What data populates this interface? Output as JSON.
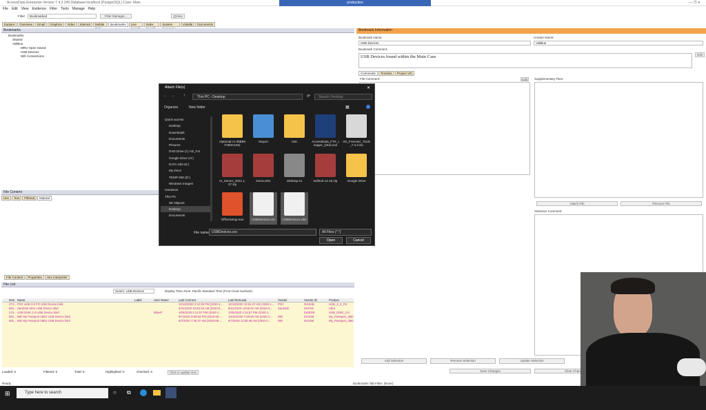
{
  "window": {
    "title": "AccessData Enterprise Version 7.4.2.249 Database:localhost (PostgreSQL) Case: Main",
    "remote_title": "production"
  },
  "menu": [
    "File",
    "Edit",
    "View",
    "Evidence",
    "Filter",
    "Tools",
    "Manage",
    "Help"
  ],
  "toolbar": {
    "filter_label": "Filter:",
    "filter_value": "Bookmarked",
    "filter_manager": "Filter Manager...",
    "qview": "QView"
  },
  "tabs": [
    "Explore",
    "Overview",
    "Email",
    "Graphics",
    "Video",
    "Internet",
    "Mobile Data",
    "Bookmarks",
    "Live Search",
    "Index Search",
    "System Summary",
    "Volatile",
    "Documents"
  ],
  "bookmarks_panel": {
    "header": "Bookmarks",
    "tree": [
      "Bookmarks",
      "Shared",
      "VolBlue",
      "MRU Open Saved",
      "USB Devices",
      "Wifi Connections"
    ]
  },
  "file_content": {
    "header": "File Content",
    "subtabs": [
      "Hex",
      "Text",
      "Filtered",
      "Natural"
    ]
  },
  "bottom_tabs": [
    "File Content",
    "Properties",
    "Hex Interpreter"
  ],
  "file_list": {
    "header": "File List",
    "summary": "Summ: USB Devices",
    "timezone": "Display Time Zone: Pacific Standard Time  (From local machine)",
    "columns": [
      "Item",
      "Name",
      "Label",
      "User Name",
      "Last Connect",
      "Last Removal",
      "Vendor",
      "Vendor ID",
      "Product"
    ],
    "rows": [
      [
        "274...",
        "PNY USB 3.0 FD USB Device.lnkd",
        "",
        "",
        "12/10/2020 2:12:28 PM (2020-1...",
        "12/10/2020 10:51:47 AM (2020-1...",
        "PNY",
        "0x154B",
        "USB_3_0_FD"
      ],
      [
        "591...",
        "SanDisk Ultra USB Device.lnkd",
        "",
        "",
        "8/31/2020 10:53:33 AM (2020-0...",
        "8/31/2020 10:55:31 AM (2020-0...",
        "SanDisk",
        "0x0781",
        "Ultra"
      ],
      [
        "274...",
        "USB DISK 2.0 USB Device.lnkd",
        "",
        "iBlueP",
        "10/5/2020 2:12:57 PM (2020-1...",
        "10/5/2020 2:13:57 PM (2020-1...",
        "",
        "0x0ED9",
        "USB_DISK_2.0"
      ],
      [
        "591...",
        "WD My Passport 25E2 USB Device.lnkd",
        "",
        "",
        "9/7/2020 3:59:53 PM (2020-09-...",
        "10/15/2020 7:56:50 AM (2020-1...",
        "WD",
        "0x1058",
        "My_Passport_25E2"
      ],
      [
        "591...",
        "WD My Passport 25E2 USB Device.lnkd",
        "",
        "",
        "9/7/2020 7:36:37 AM (2020-09-...",
        "9/7/2020 11:50:48 AM (2020-0...",
        "WD",
        "0x1058",
        "My_Passport_25E2"
      ]
    ],
    "status": {
      "loaded": "Loaded: 5",
      "filtered": "Filtered: 5",
      "total": "Total: 5",
      "highlighted": "Highlighted: 0",
      "checked": "Checked: 3",
      "update": "Click to update size"
    }
  },
  "bookmark_info": {
    "header": "Bookmark Information",
    "name_label": "Bookmark Name:",
    "name_value": "USB Devices",
    "creator_label": "Creator Name:",
    "creator_value": "VolBlue",
    "comment_label": "Bookmark Comment:",
    "comment_value": "USB Devices found within the Main Case",
    "edit": "Edit",
    "subtabs": [
      "Comments",
      "Timeline",
      "Project VIC"
    ],
    "file_comment": "File Comment:",
    "supp_files": "Supplementary Files:",
    "attach_file": "Attach File",
    "remove_file": "Remove File",
    "selection_comment": "Selection Comment:",
    "bottom_buttons": [
      "Add Selection",
      "Remove Selection",
      "Update Selection"
    ],
    "save_changes": "Save Changes",
    "clear_changes": "Clear Changes"
  },
  "status_bar": {
    "left": "Ready",
    "mid": "Bookmarks Tab Filter: (None)"
  },
  "dialog": {
    "title": "Attach File(s)",
    "breadcrumb": [
      "This PC",
      "Desktop"
    ],
    "search_placeholder": "Search Desktop",
    "organize": "Organize",
    "new_folder": "New folder",
    "nav": [
      "Quick access",
      "Desktop",
      "Downloads",
      "Documents",
      "Pictures",
      "DVD Drive (I:) AD_For",
      "Google Drive (H:)",
      "DATA-250 (E:)",
      "My Drive",
      "TEMP-250 (D:)",
      "Windows Images",
      "OneDrive",
      "This PC",
      "3D Objects",
      "Desktop",
      "Documents"
    ],
    "files": [
      {
        "name": "Optional-AI-39B89F350C548)",
        "color": "#f5c34a"
      },
      {
        "name": "Report",
        "color": "#4a8fd6"
      },
      {
        "name": "test",
        "color": "#f5c34a"
      },
      {
        "name": "AccessData_FTK_Imager_(x64).exe",
        "color": "#1f3f7a"
      },
      {
        "name": "AD_Forensic_Tools_7.4.2.iso",
        "color": "#d8d8d8"
      },
      {
        "name": "AI_Server_2021.1.27.zip",
        "color": "#a63d3d"
      },
      {
        "name": "Demo.001",
        "color": "#a63d3d"
      },
      {
        "name": "desktop.ini",
        "color": "#888888"
      },
      {
        "name": "exiftool-12.16.zip",
        "color": "#a63d3d"
      },
      {
        "name": "Google Drive",
        "color": "#f5c34a"
      },
      {
        "name": "OfficeSetup.exe",
        "color": "#e0522b"
      },
      {
        "name": "USBDevices.csv",
        "color": "#f0f0f0"
      },
      {
        "name": "USBDevices.xlsx",
        "color": "#f0f0f0"
      }
    ],
    "filename_label": "File name:",
    "filename_value": "USBDevices.csv",
    "filetype": "All Files (*.*)",
    "open": "Open",
    "cancel": "Cancel"
  },
  "taskbar": {
    "search_placeholder": "Type here to search"
  }
}
